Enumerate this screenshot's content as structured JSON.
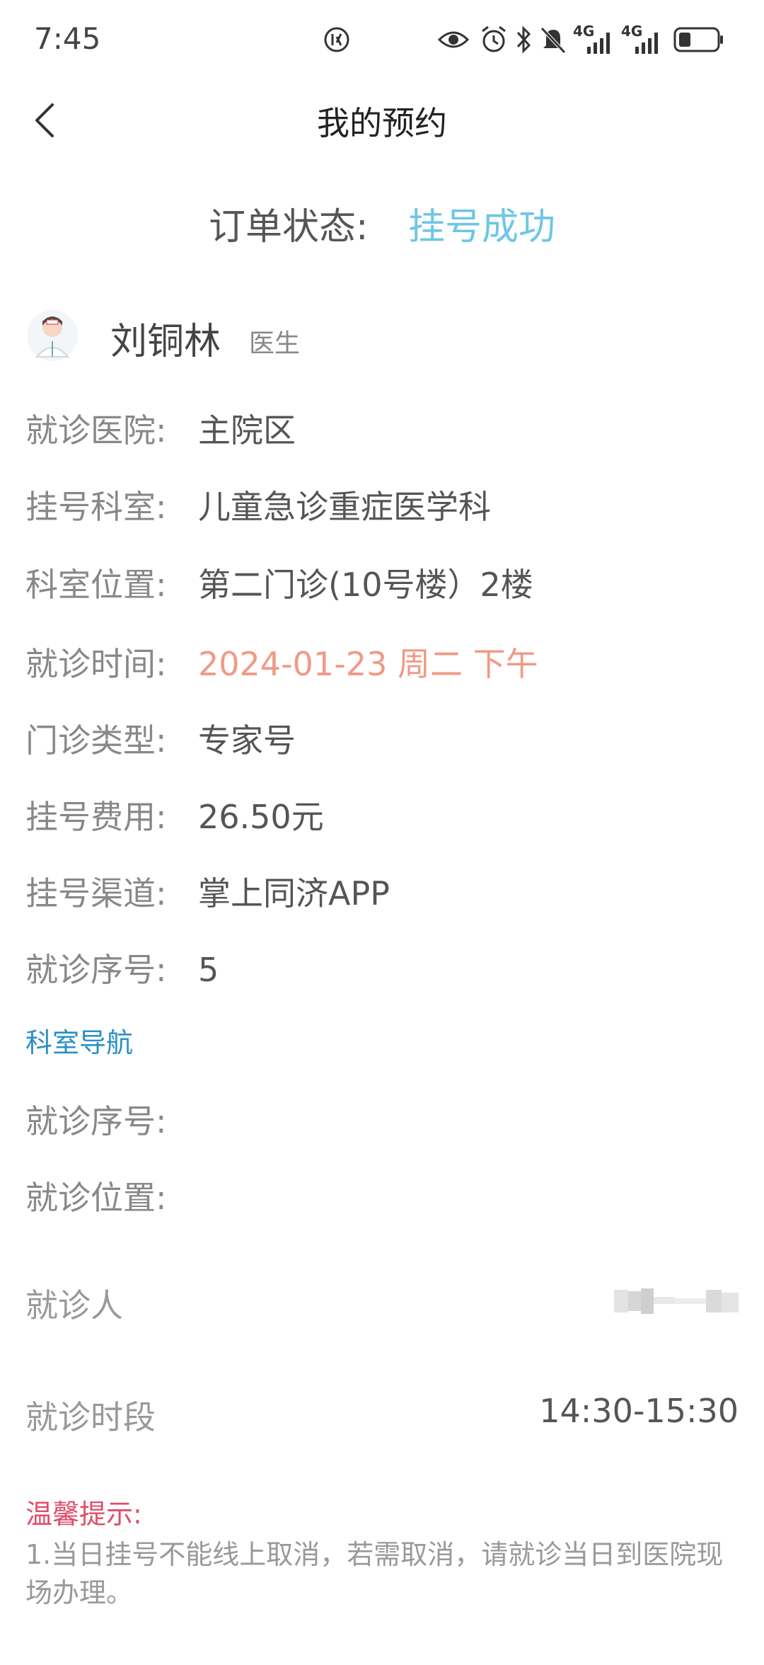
{
  "status_bar": {
    "time": "7:45",
    "icons": [
      "app-badge-icon",
      "eye-icon",
      "alarm-icon",
      "bluetooth-icon",
      "mute-icon",
      "signal-4g-icon",
      "signal-4g-icon",
      "battery-icon"
    ],
    "net1": "4G",
    "net2": "4G"
  },
  "header": {
    "title": "我的预约"
  },
  "order": {
    "label": "订单状态:",
    "value": "挂号成功",
    "value_color": "#6ec6e6"
  },
  "doctor": {
    "name": "刘铜林",
    "title": "医生"
  },
  "info": {
    "hospital": {
      "label": "就诊医院:",
      "value": "主院区"
    },
    "dept": {
      "label": "挂号科室:",
      "value": "儿童急诊重症医学科"
    },
    "location": {
      "label": "科室位置:",
      "value": "第二门诊(10号楼）2楼"
    },
    "time": {
      "label": "就诊时间:",
      "value": "2024-01-23 周二 下午"
    },
    "type": {
      "label": "门诊类型:",
      "value": "专家号"
    },
    "fee": {
      "label": "挂号费用:",
      "value": "26.50元"
    },
    "channel": {
      "label": "挂号渠道:",
      "value": "掌上同济APP"
    },
    "seq": {
      "label": "就诊序号:",
      "value": "5"
    }
  },
  "dept_nav": {
    "link": "科室导航",
    "seq_label": "就诊序号:",
    "pos_label": "就诊位置:"
  },
  "patient": {
    "label": "就诊人"
  },
  "slot": {
    "label": "就诊时段",
    "value": "14:30-15:30"
  },
  "tips": {
    "title": "温馨提示:",
    "text": "1.当日挂号不能线上取消，若需取消，请就诊当日到医院现场办理。"
  },
  "colors": {
    "accent": "#6ec6e6",
    "time_red": "#f09a86",
    "link_blue": "#2a8fc5",
    "tip_red": "#e04c6a"
  }
}
